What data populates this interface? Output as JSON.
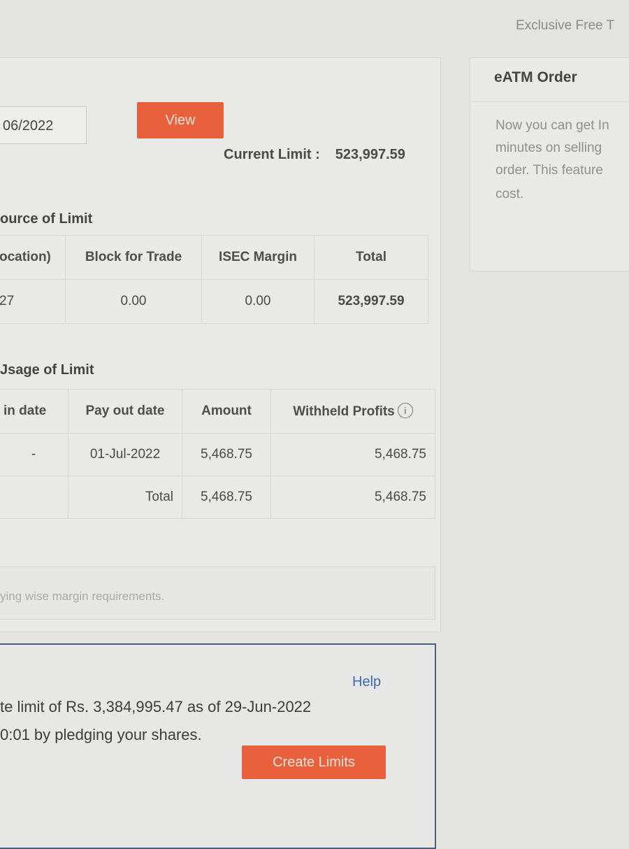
{
  "topbar": {
    "promo_text": "Exclusive Free T"
  },
  "filter": {
    "date_value": "06/2022",
    "view_label": "View",
    "current_limit_label": "Current Limit :",
    "current_limit_value": "523,997.59"
  },
  "source_of_limit": {
    "title": "ource of Limit",
    "headers": [
      "ocation)",
      "Block for Trade",
      "ISEC Margin",
      "Total"
    ],
    "row": [
      "27",
      "0.00",
      "0.00",
      "523,997.59"
    ]
  },
  "usage_of_limit": {
    "title": "Jsage of Limit",
    "headers": [
      "in date",
      "Pay out date",
      "Amount",
      "Withheld Profits"
    ],
    "info_glyph": "i",
    "rows": [
      [
        "-",
        "01-Jul-2022",
        "5,468.75",
        "5,468.75"
      ],
      [
        "",
        "Total",
        "5,468.75",
        "5,468.75"
      ]
    ]
  },
  "underlying": {
    "text": "ying wise margin requirements."
  },
  "pledge": {
    "help_label": "Help",
    "line1": "te limit of Rs. 3,384,995.47 as of 29-Jun-2022",
    "line2": "0:01 by pledging your shares.",
    "create_label": "Create Limits"
  },
  "eatm": {
    "title": "eATM Order",
    "lines": [
      "Now you can get In",
      "minutes on selling",
      "order. This feature",
      "cost."
    ]
  },
  "colors": {
    "accent": "#e8603c",
    "link": "#3d6ab0",
    "pledge_border": "#4b5e86"
  }
}
